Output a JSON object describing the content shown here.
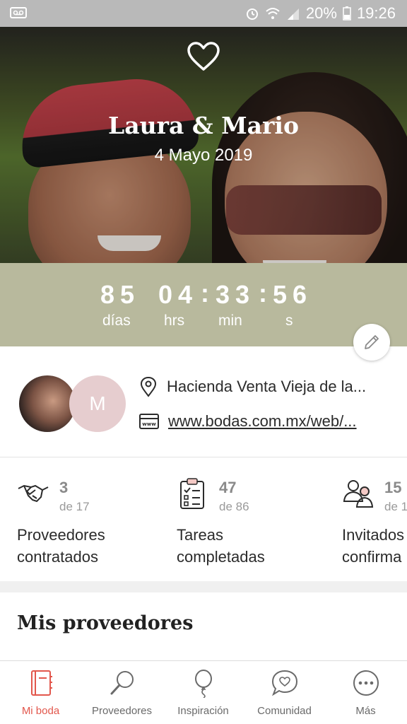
{
  "status_bar": {
    "battery": "20%",
    "time": "19:26"
  },
  "hero": {
    "names": "Laura & Mario",
    "date": "4 Mayo 2019"
  },
  "countdown": {
    "days": "85",
    "hours": "04",
    "minutes": "33",
    "seconds": "56",
    "days_label": "días",
    "hours_label": "hrs",
    "minutes_label": "min",
    "seconds_label": "s"
  },
  "profile": {
    "avatar_initial": "M",
    "venue": "Hacienda Venta Vieja de la...",
    "website": "www.bodas.com.mx/web/..."
  },
  "stats": [
    {
      "count": "3",
      "of": "de 17",
      "label": "Proveedores\ncontratados"
    },
    {
      "count": "47",
      "of": "de 86",
      "label": "Tareas\ncompletadas"
    },
    {
      "count": "15",
      "of": "de 1",
      "label": "Invitados\nconfirma"
    }
  ],
  "sections": {
    "providers_title": "Mis proveedores"
  },
  "bottom_nav": {
    "items": [
      {
        "label": "Mi boda",
        "icon": "notebook-icon",
        "active": true
      },
      {
        "label": "Proveedores",
        "icon": "magnifier-icon",
        "active": false
      },
      {
        "label": "Inspiración",
        "icon": "balloon-icon",
        "active": false
      },
      {
        "label": "Comunidad",
        "icon": "chat-heart-icon",
        "active": false
      },
      {
        "label": "Más",
        "icon": "more-dots-icon",
        "active": false
      }
    ]
  },
  "colors": {
    "status_bar": "#b9b9b9",
    "countdown_band": "#b8b99d",
    "accent": "#e2574c",
    "avatar_bg": "#e6cdcf"
  }
}
